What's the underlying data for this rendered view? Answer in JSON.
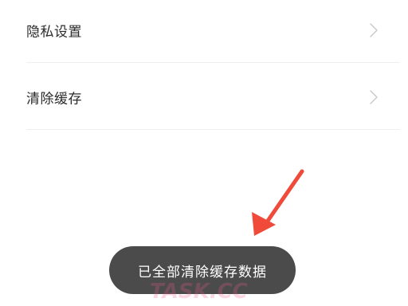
{
  "settings": {
    "items": [
      {
        "label": "隐私设置",
        "icon": "chevron-right-icon"
      },
      {
        "label": "清除缓存",
        "icon": "chevron-right-icon"
      }
    ]
  },
  "toast": {
    "message": "已全部清除缓存数据"
  },
  "annotation": {
    "arrow_color": "#f04a3a"
  },
  "watermark": {
    "text": "TASK.CC"
  },
  "colors": {
    "toast_background": "#4b4b4b",
    "label_text": "#2b2b2b"
  }
}
